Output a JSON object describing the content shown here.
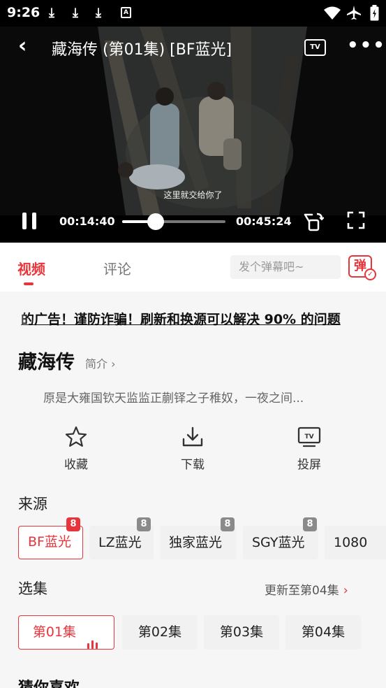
{
  "status_bar": {
    "time": "9:26",
    "icons": [
      "download-icon",
      "download-icon",
      "download-icon",
      "a-box-icon",
      "wifi-icon",
      "airplane-icon",
      "battery-icon"
    ],
    "a_label": "A"
  },
  "player": {
    "back_icon": "chevron-left-icon",
    "title": "藏海传 (第01集) [BF蓝光]",
    "tv_label": "TV",
    "more_icon": "more-dots-icon",
    "subtitle": "这里就交给你了",
    "current_time": "00:14:40",
    "duration": "00:45:24",
    "progress": 0.323,
    "play_state": "pause-icon",
    "rotate_icon": "rotate-screen-icon",
    "fullscreen_icon": "fullscreen-icon"
  },
  "tabs": {
    "video": "视频",
    "comments": "评论",
    "danmaku_placeholder": "发个弹幕吧~",
    "danmaku_button": "弹"
  },
  "notice": "的广告！谨防诈骗！刷新和换源可以解决 90% 的问题",
  "show": {
    "title": "藏海传",
    "intro_link": "简介",
    "synopsis": "原是大雍国钦天监监正蒯铎之子稚奴，一夜之间..."
  },
  "actions": [
    {
      "label": "收藏",
      "icon": "star-icon"
    },
    {
      "label": "下载",
      "icon": "download-icon"
    },
    {
      "label": "投屏",
      "icon": "tv-cast-icon"
    }
  ],
  "sources": {
    "title": "来源",
    "items": [
      {
        "label": "BF蓝光",
        "count": "8",
        "active": true
      },
      {
        "label": "LZ蓝光",
        "count": "8",
        "active": false
      },
      {
        "label": "独家蓝光",
        "count": "8",
        "active": false
      },
      {
        "label": "SGY蓝光",
        "count": "8",
        "active": false
      },
      {
        "label": "1080",
        "count": "",
        "active": false
      }
    ]
  },
  "episodes": {
    "title": "选集",
    "update_text": "更新至第04集",
    "items": [
      {
        "label": "第01集",
        "active": true
      },
      {
        "label": "第02集",
        "active": false
      },
      {
        "label": "第03集",
        "active": false
      },
      {
        "label": "第04集",
        "active": false
      }
    ]
  },
  "recommend": {
    "title": "猜你喜欢"
  },
  "colors": {
    "accent": "#e8353b",
    "background": "#f6f6f6",
    "chip": "#f1f1f1"
  }
}
